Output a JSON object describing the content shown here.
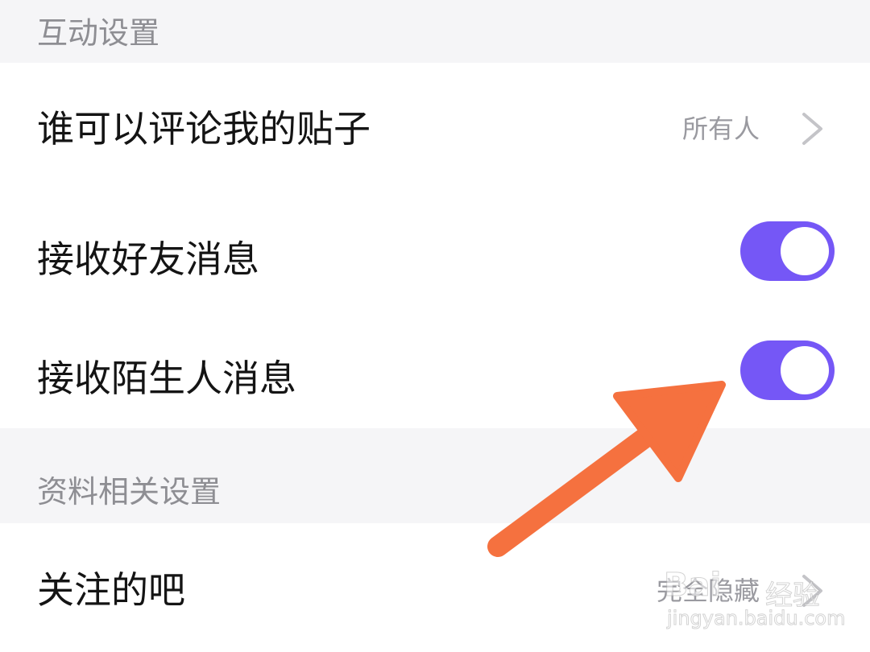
{
  "sections": [
    {
      "header": "互动设置",
      "rows": [
        {
          "label": "谁可以评论我的贴子",
          "value": "所有人",
          "type": "link"
        },
        {
          "label": "接收好友消息",
          "type": "toggle",
          "on": true
        },
        {
          "label": "接收陌生人消息",
          "type": "toggle",
          "on": true
        }
      ]
    },
    {
      "header": "资料相关设置",
      "rows": [
        {
          "label": "关注的吧",
          "value": "完全隐藏",
          "type": "link"
        }
      ]
    }
  ],
  "colors": {
    "toggle_on": "#7557f6",
    "annotation_arrow": "#f5713f",
    "background": "#f5f5f7"
  },
  "watermark": {
    "brand": "Bai",
    "sub": "经验",
    "url": "jingyan.baidu.com"
  }
}
